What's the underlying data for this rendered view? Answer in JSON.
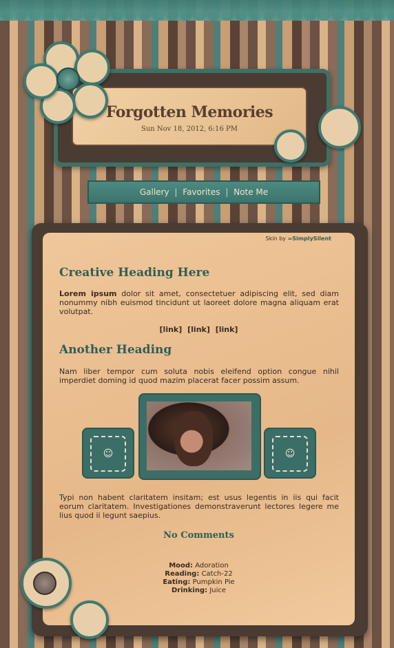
{
  "header": {
    "title": "Forgotten Memories",
    "date": "Sun Nov 18, 2012, 6:16 PM"
  },
  "nav": {
    "items": [
      {
        "label": "Gallery"
      },
      {
        "label": "Favorites"
      },
      {
        "label": "Note Me"
      }
    ]
  },
  "credit": {
    "prefix": "Skin by",
    "author": "=SimplySilent"
  },
  "content": {
    "heading1": "Creative Heading Here",
    "para1_bold": "Lorem ipsum",
    "para1_rest": "dolor sit amet, consectetuer adipiscing elit, sed diam nonummy nibh euismod tincidunt ut laoreet dolore magna aliquam erat volutpat.",
    "links": [
      "[link]",
      "[link]",
      "[link]"
    ],
    "heading2": "Another Heading",
    "para2": "Nam liber tempor cum soluta nobis eleifend option congue nihil imperdiet doming id quod mazim placerat facer possim assum.",
    "para3": "Typi non habent claritatem insitam; est usus legentis in iis qui facit eorum claritatem. Investigationes demonstraverunt lectores legere me lius quod ii legunt saepius.",
    "comments": "No Comments"
  },
  "mood": {
    "mood_label": "Mood:",
    "mood_value": "Adoration",
    "reading_label": "Reading:",
    "reading_value": "Catch-22",
    "eating_label": "Eating:",
    "eating_value": "Pumpkin Pie",
    "drinking_label": "Drinking:",
    "drinking_value": "Juice"
  },
  "colors": {
    "teal": "#3f7a70",
    "paper": "#e6b888",
    "brown": "#4a3b33"
  },
  "icons": {
    "thumb_icon": "smiley-icon"
  }
}
